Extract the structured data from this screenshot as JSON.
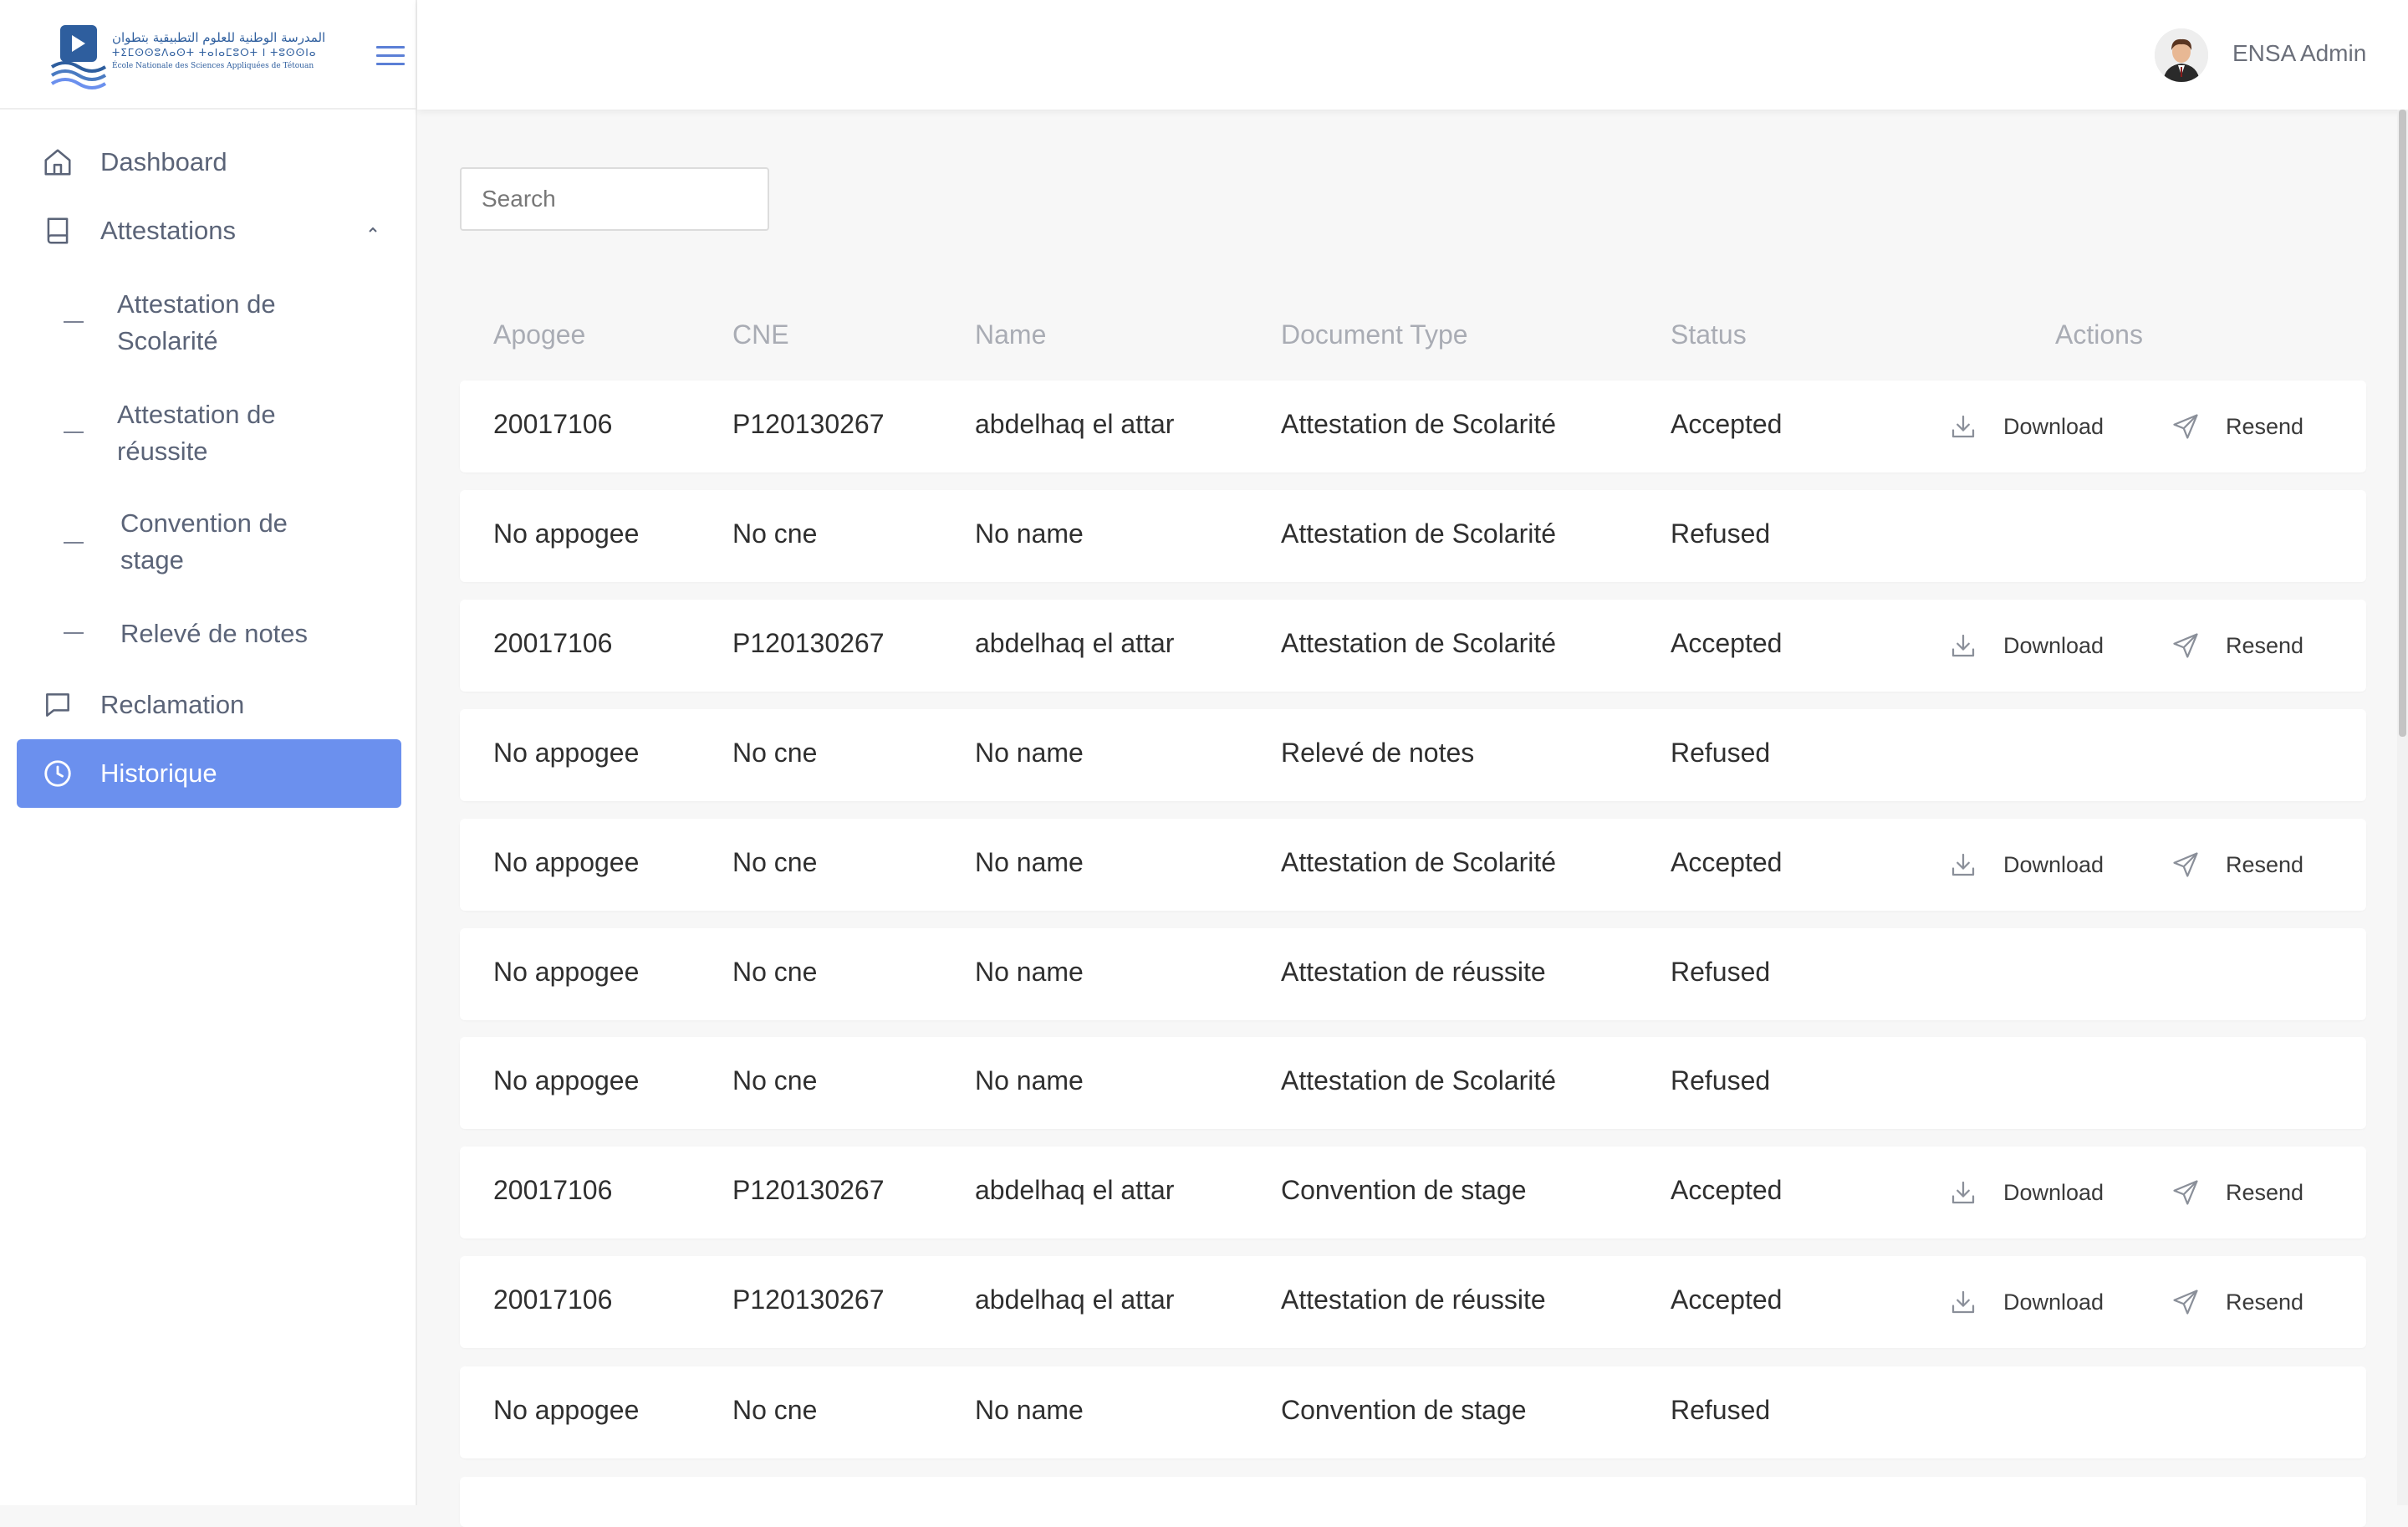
{
  "brand": {
    "logo_arabic": "المدرسة الوطنية للعلوم التطبيقية بتطوان",
    "logo_tifinagh": "ⵜⵉⵎⵙⵙⵓⴷⴰⵙⵜ ⵜⴰⵏⴰⵎⵓⵔⵜ ⵏ ⵜⵓⵙⵙⵏⴰ",
    "logo_french": "École Nationale des Sciences Appliquées de Tétouan"
  },
  "header": {
    "username": "ENSA Admin"
  },
  "sidebar": {
    "items": [
      {
        "label": "Dashboard",
        "icon": "home-icon"
      },
      {
        "label": "Attestations",
        "icon": "book-icon",
        "expanded": true
      },
      {
        "label": "Reclamation",
        "icon": "chat-icon"
      },
      {
        "label": "Historique",
        "icon": "clock-icon",
        "active": true
      }
    ],
    "subitems": [
      {
        "label": "Attestation de Scolarité"
      },
      {
        "label": "Attestation de réussite"
      },
      {
        "label": "Convention de stage"
      },
      {
        "label": "Relevé de notes"
      }
    ]
  },
  "search": {
    "placeholder": "Search",
    "value": ""
  },
  "table": {
    "headers": {
      "apogee": "Apogee",
      "cne": "CNE",
      "name": "Name",
      "doc": "Document Type",
      "status": "Status",
      "actions": "Actions"
    },
    "action_labels": {
      "download": "Download",
      "resend": "Resend"
    },
    "rows": [
      {
        "apogee": "20017106",
        "cne": "P120130267",
        "name": "abdelhaq el attar",
        "doc": "Attestation de Scolarité",
        "status": "Accepted"
      },
      {
        "apogee": "No appogee",
        "cne": "No cne",
        "name": "No name",
        "doc": "Attestation de Scolarité",
        "status": "Refused"
      },
      {
        "apogee": "20017106",
        "cne": "P120130267",
        "name": "abdelhaq el attar",
        "doc": "Attestation de Scolarité",
        "status": "Accepted"
      },
      {
        "apogee": "No appogee",
        "cne": "No cne",
        "name": "No name",
        "doc": "Relevé de notes",
        "status": "Refused"
      },
      {
        "apogee": "No appogee",
        "cne": "No cne",
        "name": "No name",
        "doc": "Attestation de Scolarité",
        "status": "Accepted"
      },
      {
        "apogee": "No appogee",
        "cne": "No cne",
        "name": "No name",
        "doc": "Attestation de réussite",
        "status": "Refused"
      },
      {
        "apogee": "No appogee",
        "cne": "No cne",
        "name": "No name",
        "doc": "Attestation de Scolarité",
        "status": "Refused"
      },
      {
        "apogee": "20017106",
        "cne": "P120130267",
        "name": "abdelhaq el attar",
        "doc": "Convention de stage",
        "status": "Accepted"
      },
      {
        "apogee": "20017106",
        "cne": "P120130267",
        "name": "abdelhaq el attar",
        "doc": "Attestation de réussite",
        "status": "Accepted"
      },
      {
        "apogee": "No appogee",
        "cne": "No cne",
        "name": "No name",
        "doc": "Convention de stage",
        "status": "Refused"
      }
    ]
  },
  "colors": {
    "accent": "#6b90ee",
    "brand": "#2e5e9e",
    "background": "#f7f7f7"
  }
}
